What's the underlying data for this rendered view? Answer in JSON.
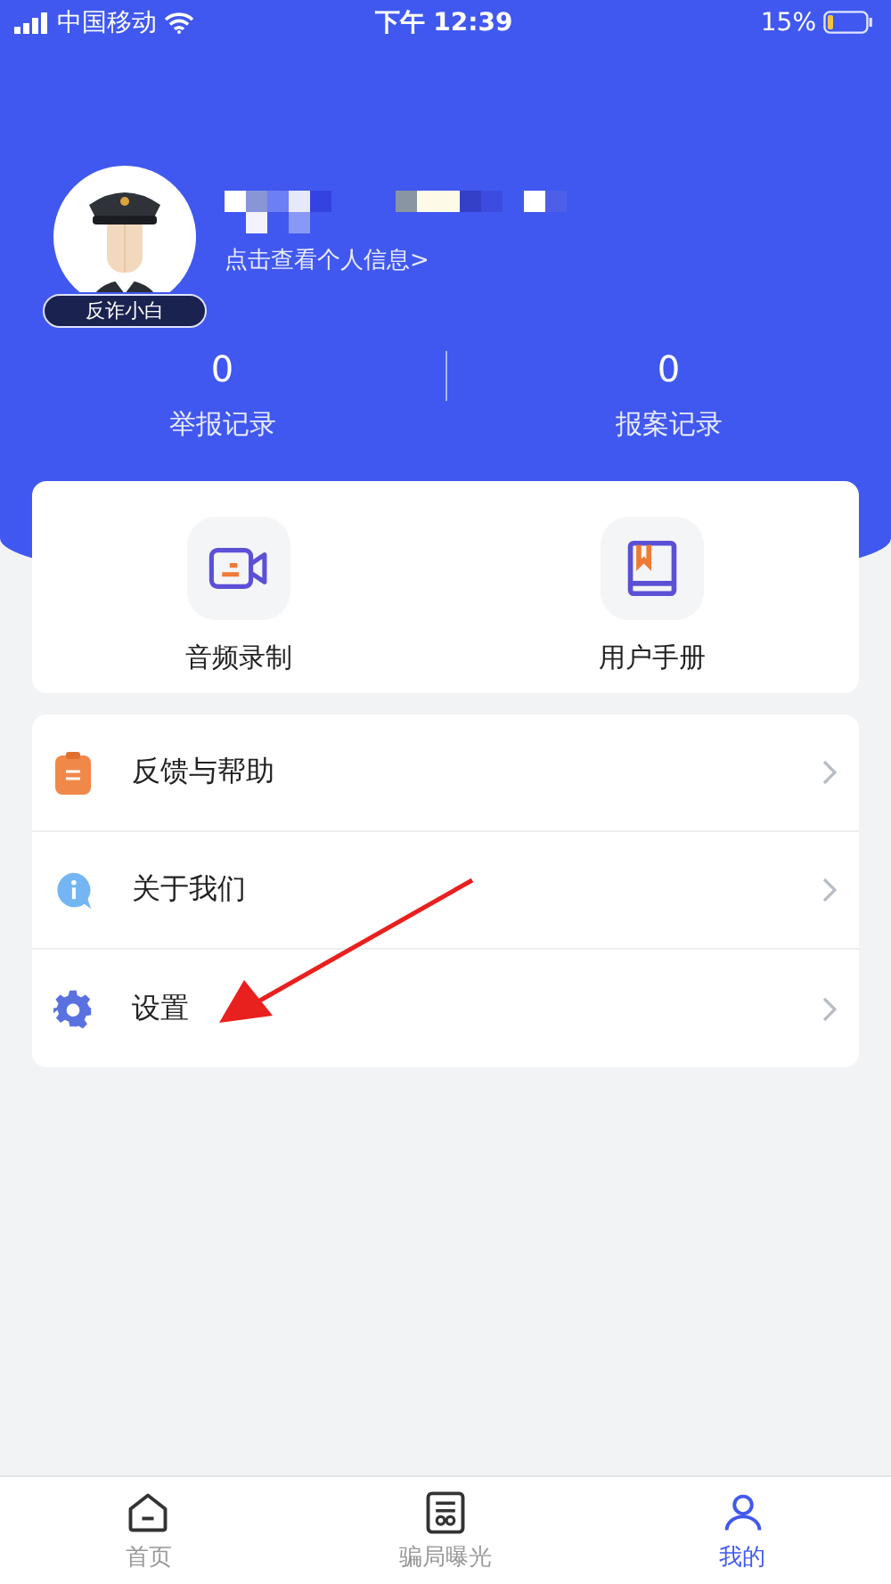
{
  "status_bar": {
    "carrier": "中国移动",
    "time": "下午 12:39",
    "battery": "15%"
  },
  "profile": {
    "badge": "反诈小白",
    "link": "点击查看个人信息>"
  },
  "stats": [
    {
      "value": "0",
      "label": "举报记录"
    },
    {
      "value": "0",
      "label": "报案记录"
    }
  ],
  "shortcuts": [
    {
      "kind": "video",
      "label": "音频录制"
    },
    {
      "kind": "book",
      "label": "用户手册"
    }
  ],
  "menu": [
    {
      "kind": "feedback",
      "label": "反馈与帮助"
    },
    {
      "kind": "about",
      "label": "关于我们"
    },
    {
      "kind": "settings",
      "label": "设置"
    }
  ],
  "tabs": [
    {
      "kind": "home",
      "label": "首页",
      "selected": false
    },
    {
      "kind": "exposure",
      "label": "骗局曝光",
      "selected": false
    },
    {
      "kind": "me",
      "label": "我的",
      "selected": true
    }
  ]
}
